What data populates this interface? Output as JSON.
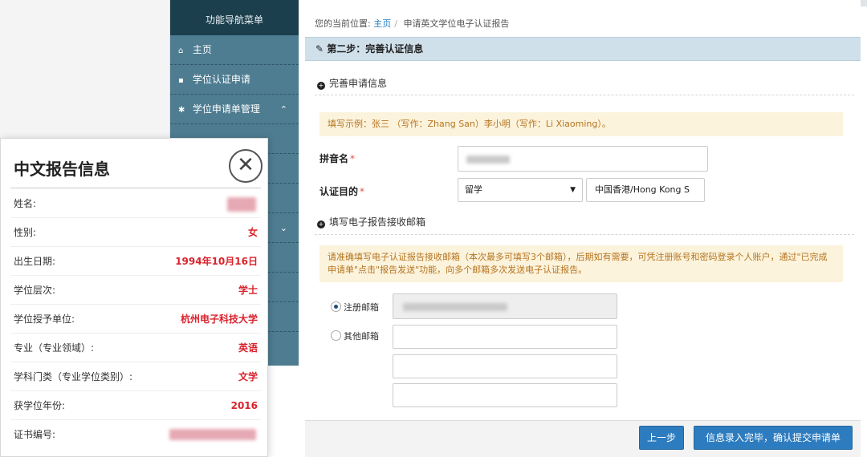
{
  "sidebar": {
    "title": "功能导航菜单",
    "items": [
      {
        "label": "主页",
        "icon": "home-icon"
      },
      {
        "label": "学位认证申请",
        "icon": "document-icon"
      },
      {
        "label": "学位申请单管理",
        "icon": "gear-icon"
      }
    ]
  },
  "breadcrumb": {
    "prefix": "您的当前位置:",
    "home": "主页",
    "current": "申请英文学位电子认证报告"
  },
  "step": {
    "title": "第二步：完善认证信息"
  },
  "section1": {
    "title": "完善申请信息",
    "tip": "填写示例：张三 （写作：Zhang San）李小明（写作：Li Xiaoming）。"
  },
  "form": {
    "pinyin_label": "拼音名",
    "purpose_label": "认证目的",
    "required_mark": "*",
    "purpose_value": "留学",
    "country_value": "中国香港/Hong Kong S"
  },
  "section2": {
    "title": "填写电子报告接收邮箱",
    "tip": "请准确填写电子认证报告接收邮箱（本次最多可填写3个邮箱），后期如有需要，可凭注册账号和密码登录个人账户，通过\"已完成申请单\"点击\"报告发送\"功能，向多个邮箱多次发送电子认证报告。",
    "registered_label": "注册邮箱",
    "other_label": "其他邮箱"
  },
  "buttons": {
    "prev": "上一步",
    "submit": "信息录入完毕，确认提交申请单"
  },
  "popup": {
    "title": "中文报告信息",
    "close": "✕",
    "rows": [
      {
        "key": "姓名:",
        "value": ""
      },
      {
        "key": "性别:",
        "value": "女"
      },
      {
        "key": "出生日期:",
        "value": "1994年10月16日"
      },
      {
        "key": "学位层次:",
        "value": "学士"
      },
      {
        "key": "学位授予单位:",
        "value": "杭州电子科技大学"
      },
      {
        "key": "专业（专业领域）:",
        "value": "英语"
      },
      {
        "key": "学科门类（专业学位类别）:",
        "value": "文学"
      },
      {
        "key": "获学位年份:",
        "value": "2016"
      },
      {
        "key": "证书编号:",
        "value": ""
      }
    ]
  },
  "colors": {
    "sidebar_bg": "#4e7c91",
    "sidebar_title_bg": "#1c3f4d",
    "step_bar_bg": "#cfe0ea",
    "tip_bg": "#fcf3dc",
    "tip_text": "#b5741f",
    "button_bg": "#2d7cc0",
    "popup_value": "#d9232d"
  }
}
